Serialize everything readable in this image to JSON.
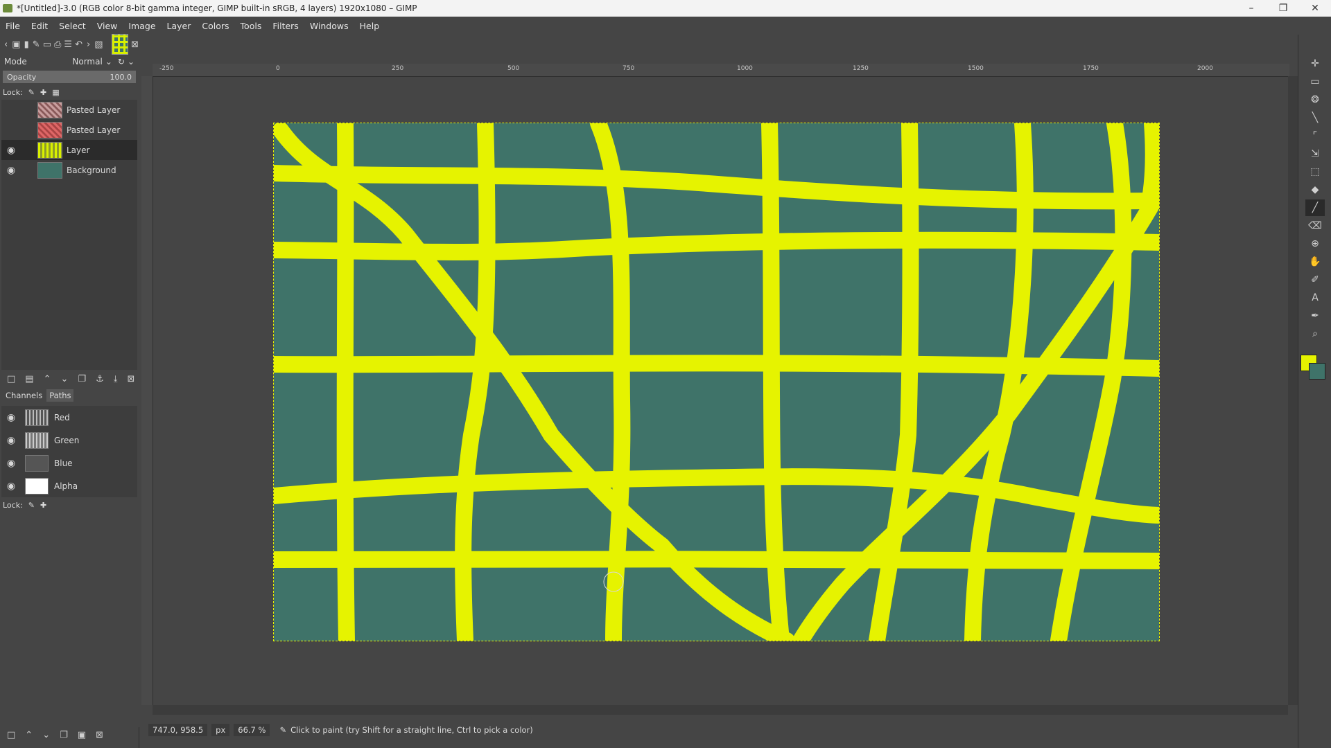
{
  "window": {
    "title": "*[Untitled]-3.0 (RGB color 8-bit gamma integer, GIMP built-in sRGB, 4 layers) 1920x1080 – GIMP"
  },
  "menubar": [
    "File",
    "Edit",
    "Select",
    "View",
    "Image",
    "Layer",
    "Colors",
    "Tools",
    "Filters",
    "Windows",
    "Help"
  ],
  "layers_panel": {
    "mode_label": "Mode",
    "mode_value": "Normal",
    "opacity_label": "Opacity",
    "opacity_value": "100.0",
    "lock_label": "Lock:",
    "layers": [
      {
        "name": "Pasted Layer",
        "visible": false
      },
      {
        "name": "Pasted Layer",
        "visible": false
      },
      {
        "name": "Layer",
        "visible": true,
        "active": true
      },
      {
        "name": "Background",
        "visible": true
      }
    ]
  },
  "channels_panel": {
    "tabs": [
      "Channels",
      "Paths"
    ],
    "channels": [
      {
        "name": "Red"
      },
      {
        "name": "Green"
      },
      {
        "name": "Blue"
      },
      {
        "name": "Alpha"
      }
    ],
    "lock_label": "Lock:"
  },
  "ruler": {
    "top_labels": [
      "-250",
      "0",
      "250",
      "500",
      "750",
      "1000",
      "1250",
      "1500",
      "1750",
      "2000"
    ]
  },
  "canvas": {
    "background_color": "#3f7369",
    "stroke_color": "#e6f300"
  },
  "statusbar": {
    "coords": "747.0, 958.5",
    "unit": "px",
    "zoom": "66.7 %",
    "message": "Click to paint (try Shift for a straight line, Ctrl to pick a color)"
  },
  "colors": {
    "foreground": "#e6f300",
    "background": "#3f7369"
  }
}
